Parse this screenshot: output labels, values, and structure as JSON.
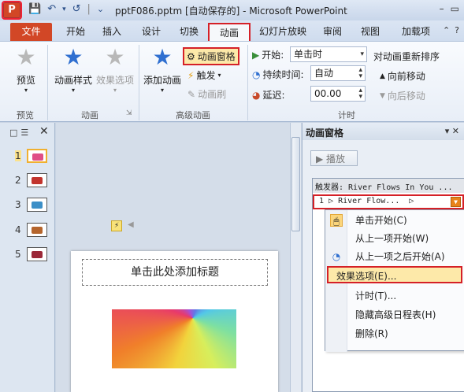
{
  "titlebar": {
    "title": "pptF086.pptm [自动保存的] - Microsoft PowerPoint",
    "app_icon": "P",
    "qat_save_icon": "💾",
    "qat_undo_icon": "↶",
    "qat_undo_arrow": "▾",
    "qat_redo_icon": "↺",
    "qat_separator": "|",
    "qat_customize_icon": "⌄",
    "win_min": "–",
    "win_restore": "▭"
  },
  "tabs": {
    "file": "文件",
    "home": "开始",
    "insert": "插入",
    "design": "设计",
    "transitions": "切换",
    "animations": "动画",
    "slideshow": "幻灯片放映",
    "review": "审阅",
    "view": "视图",
    "addins": "加载项",
    "collapse_icon": "⌃",
    "help_icon": "?"
  },
  "ribbon": {
    "preview": {
      "btn": "预览",
      "group": "预览",
      "arrow": "▾"
    },
    "animation": {
      "styles": "动画样式",
      "effect_options": "效果选项",
      "group": "动画",
      "styles_arrow": "▾",
      "effect_arrow": "▾",
      "launcher": "⇲"
    },
    "advanced": {
      "add_animation": "添加动画",
      "add_arrow": "▾",
      "animation_pane": "动画窗格",
      "trigger": "触发",
      "trigger_arrow": "▾",
      "animation_painter": "动画刷",
      "group": "高级动画"
    },
    "timing": {
      "start_label": "开始:",
      "start_value": "单击时",
      "duration_label": "持续时间:",
      "duration_value": "自动",
      "delay_label": "延迟:",
      "delay_value": "00.00",
      "group": "计时",
      "reorder_title": "对动画重新排序",
      "move_earlier": "向前移动",
      "move_later": "向后移动"
    }
  },
  "slides_panel": {
    "tab_slides": "□",
    "tab_outline": "☰",
    "close": "✕",
    "slides": [
      {
        "num": "1",
        "selected": true,
        "color": "#e04e86"
      },
      {
        "num": "2",
        "selected": false,
        "color": "#c2342d"
      },
      {
        "num": "3",
        "selected": false,
        "color": "#3c8fc7"
      },
      {
        "num": "4",
        "selected": false,
        "color": "#b5652c"
      },
      {
        "num": "5",
        "selected": false,
        "color": "#9b2838"
      }
    ]
  },
  "canvas": {
    "title_placeholder": "单击此处添加标题",
    "anim_tag": "⚡",
    "anim_play": "◀"
  },
  "anim_pane": {
    "title": "动画窗格",
    "close_icon": "▾ ✕",
    "play": "▶ 播放",
    "trigger_header": "触发器: River Flows In You ...",
    "item_num": "1",
    "item_text": "▷ River Flow...",
    "item_play_icon": "▷",
    "item_dropdown": "▼",
    "menu": [
      {
        "label": "单击开始(C)",
        "icon": "🖱",
        "checked": true
      },
      {
        "label": "从上一项开始(W)",
        "icon": "",
        "checked": false
      },
      {
        "label": "从上一项之后开始(A)",
        "icon": "◔",
        "checked": false
      },
      {
        "label": "效果选项(E)...",
        "icon": "",
        "checked": false,
        "highlighted": true
      },
      {
        "label": "计时(T)...",
        "icon": "",
        "checked": false
      },
      {
        "label": "隐藏高级日程表(H)",
        "icon": "",
        "checked": false
      },
      {
        "label": "删除(R)",
        "icon": "",
        "checked": false
      }
    ]
  }
}
